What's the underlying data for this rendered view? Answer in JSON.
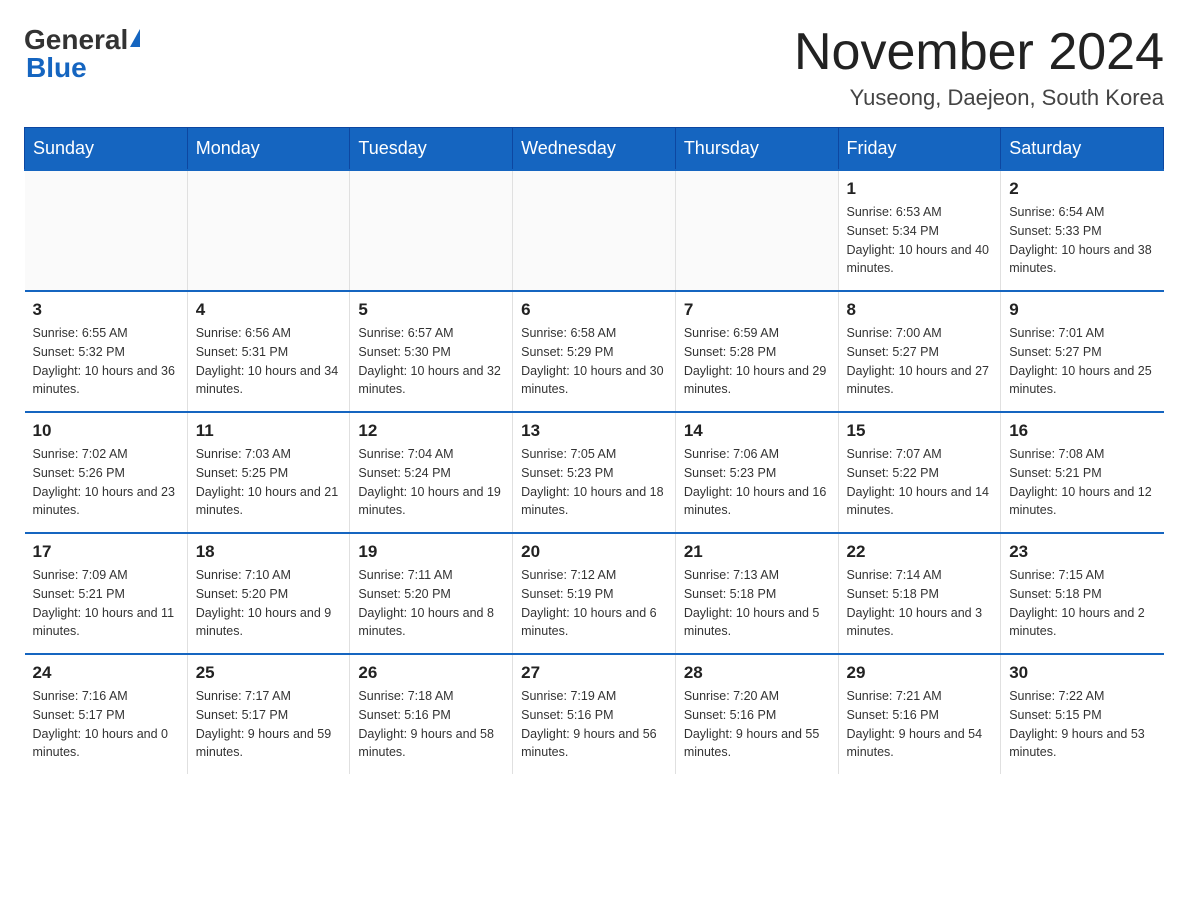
{
  "logo": {
    "general": "General",
    "blue": "Blue"
  },
  "title": {
    "month_year": "November 2024",
    "location": "Yuseong, Daejeon, South Korea"
  },
  "weekdays": [
    "Sunday",
    "Monday",
    "Tuesday",
    "Wednesday",
    "Thursday",
    "Friday",
    "Saturday"
  ],
  "weeks": [
    [
      {
        "day": "",
        "sunrise": "",
        "sunset": "",
        "daylight": ""
      },
      {
        "day": "",
        "sunrise": "",
        "sunset": "",
        "daylight": ""
      },
      {
        "day": "",
        "sunrise": "",
        "sunset": "",
        "daylight": ""
      },
      {
        "day": "",
        "sunrise": "",
        "sunset": "",
        "daylight": ""
      },
      {
        "day": "",
        "sunrise": "",
        "sunset": "",
        "daylight": ""
      },
      {
        "day": "1",
        "sunrise": "Sunrise: 6:53 AM",
        "sunset": "Sunset: 5:34 PM",
        "daylight": "Daylight: 10 hours and 40 minutes."
      },
      {
        "day": "2",
        "sunrise": "Sunrise: 6:54 AM",
        "sunset": "Sunset: 5:33 PM",
        "daylight": "Daylight: 10 hours and 38 minutes."
      }
    ],
    [
      {
        "day": "3",
        "sunrise": "Sunrise: 6:55 AM",
        "sunset": "Sunset: 5:32 PM",
        "daylight": "Daylight: 10 hours and 36 minutes."
      },
      {
        "day": "4",
        "sunrise": "Sunrise: 6:56 AM",
        "sunset": "Sunset: 5:31 PM",
        "daylight": "Daylight: 10 hours and 34 minutes."
      },
      {
        "day": "5",
        "sunrise": "Sunrise: 6:57 AM",
        "sunset": "Sunset: 5:30 PM",
        "daylight": "Daylight: 10 hours and 32 minutes."
      },
      {
        "day": "6",
        "sunrise": "Sunrise: 6:58 AM",
        "sunset": "Sunset: 5:29 PM",
        "daylight": "Daylight: 10 hours and 30 minutes."
      },
      {
        "day": "7",
        "sunrise": "Sunrise: 6:59 AM",
        "sunset": "Sunset: 5:28 PM",
        "daylight": "Daylight: 10 hours and 29 minutes."
      },
      {
        "day": "8",
        "sunrise": "Sunrise: 7:00 AM",
        "sunset": "Sunset: 5:27 PM",
        "daylight": "Daylight: 10 hours and 27 minutes."
      },
      {
        "day": "9",
        "sunrise": "Sunrise: 7:01 AM",
        "sunset": "Sunset: 5:27 PM",
        "daylight": "Daylight: 10 hours and 25 minutes."
      }
    ],
    [
      {
        "day": "10",
        "sunrise": "Sunrise: 7:02 AM",
        "sunset": "Sunset: 5:26 PM",
        "daylight": "Daylight: 10 hours and 23 minutes."
      },
      {
        "day": "11",
        "sunrise": "Sunrise: 7:03 AM",
        "sunset": "Sunset: 5:25 PM",
        "daylight": "Daylight: 10 hours and 21 minutes."
      },
      {
        "day": "12",
        "sunrise": "Sunrise: 7:04 AM",
        "sunset": "Sunset: 5:24 PM",
        "daylight": "Daylight: 10 hours and 19 minutes."
      },
      {
        "day": "13",
        "sunrise": "Sunrise: 7:05 AM",
        "sunset": "Sunset: 5:23 PM",
        "daylight": "Daylight: 10 hours and 18 minutes."
      },
      {
        "day": "14",
        "sunrise": "Sunrise: 7:06 AM",
        "sunset": "Sunset: 5:23 PM",
        "daylight": "Daylight: 10 hours and 16 minutes."
      },
      {
        "day": "15",
        "sunrise": "Sunrise: 7:07 AM",
        "sunset": "Sunset: 5:22 PM",
        "daylight": "Daylight: 10 hours and 14 minutes."
      },
      {
        "day": "16",
        "sunrise": "Sunrise: 7:08 AM",
        "sunset": "Sunset: 5:21 PM",
        "daylight": "Daylight: 10 hours and 12 minutes."
      }
    ],
    [
      {
        "day": "17",
        "sunrise": "Sunrise: 7:09 AM",
        "sunset": "Sunset: 5:21 PM",
        "daylight": "Daylight: 10 hours and 11 minutes."
      },
      {
        "day": "18",
        "sunrise": "Sunrise: 7:10 AM",
        "sunset": "Sunset: 5:20 PM",
        "daylight": "Daylight: 10 hours and 9 minutes."
      },
      {
        "day": "19",
        "sunrise": "Sunrise: 7:11 AM",
        "sunset": "Sunset: 5:20 PM",
        "daylight": "Daylight: 10 hours and 8 minutes."
      },
      {
        "day": "20",
        "sunrise": "Sunrise: 7:12 AM",
        "sunset": "Sunset: 5:19 PM",
        "daylight": "Daylight: 10 hours and 6 minutes."
      },
      {
        "day": "21",
        "sunrise": "Sunrise: 7:13 AM",
        "sunset": "Sunset: 5:18 PM",
        "daylight": "Daylight: 10 hours and 5 minutes."
      },
      {
        "day": "22",
        "sunrise": "Sunrise: 7:14 AM",
        "sunset": "Sunset: 5:18 PM",
        "daylight": "Daylight: 10 hours and 3 minutes."
      },
      {
        "day": "23",
        "sunrise": "Sunrise: 7:15 AM",
        "sunset": "Sunset: 5:18 PM",
        "daylight": "Daylight: 10 hours and 2 minutes."
      }
    ],
    [
      {
        "day": "24",
        "sunrise": "Sunrise: 7:16 AM",
        "sunset": "Sunset: 5:17 PM",
        "daylight": "Daylight: 10 hours and 0 minutes."
      },
      {
        "day": "25",
        "sunrise": "Sunrise: 7:17 AM",
        "sunset": "Sunset: 5:17 PM",
        "daylight": "Daylight: 9 hours and 59 minutes."
      },
      {
        "day": "26",
        "sunrise": "Sunrise: 7:18 AM",
        "sunset": "Sunset: 5:16 PM",
        "daylight": "Daylight: 9 hours and 58 minutes."
      },
      {
        "day": "27",
        "sunrise": "Sunrise: 7:19 AM",
        "sunset": "Sunset: 5:16 PM",
        "daylight": "Daylight: 9 hours and 56 minutes."
      },
      {
        "day": "28",
        "sunrise": "Sunrise: 7:20 AM",
        "sunset": "Sunset: 5:16 PM",
        "daylight": "Daylight: 9 hours and 55 minutes."
      },
      {
        "day": "29",
        "sunrise": "Sunrise: 7:21 AM",
        "sunset": "Sunset: 5:16 PM",
        "daylight": "Daylight: 9 hours and 54 minutes."
      },
      {
        "day": "30",
        "sunrise": "Sunrise: 7:22 AM",
        "sunset": "Sunset: 5:15 PM",
        "daylight": "Daylight: 9 hours and 53 minutes."
      }
    ]
  ]
}
